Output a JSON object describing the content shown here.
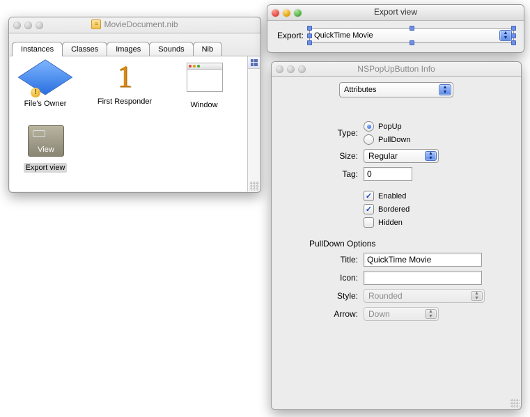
{
  "nibwin": {
    "title": "MovieDocument.nib",
    "tabs": [
      "Instances",
      "Classes",
      "Images",
      "Sounds",
      "Nib"
    ],
    "active_tab_index": 0,
    "items": {
      "owner": "File's Owner",
      "responder": "First Responder",
      "window": "Window",
      "export": "Export view"
    }
  },
  "exportwin": {
    "title": "Export view",
    "label": "Export:",
    "value": "QuickTime Movie"
  },
  "inspector": {
    "title": "NSPopUpButton Info",
    "mode": "Attributes",
    "type_label": "Type:",
    "type_options": {
      "popup": "PopUp",
      "pulldown": "PullDown"
    },
    "type_selected": "popup",
    "size_label": "Size:",
    "size_value": "Regular",
    "tag_label": "Tag:",
    "tag_value": "0",
    "checks": {
      "enabled": {
        "label": "Enabled",
        "checked": true
      },
      "bordered": {
        "label": "Bordered",
        "checked": true
      },
      "hidden": {
        "label": "Hidden",
        "checked": false
      }
    },
    "pulldown_section": "PullDown Options",
    "title_label": "Title:",
    "title_value": "QuickTime Movie",
    "icon_label": "Icon:",
    "icon_value": "",
    "style_label": "Style:",
    "style_value": "Rounded",
    "arrow_label": "Arrow:",
    "arrow_value": "Down"
  },
  "viewchip_label": "View"
}
